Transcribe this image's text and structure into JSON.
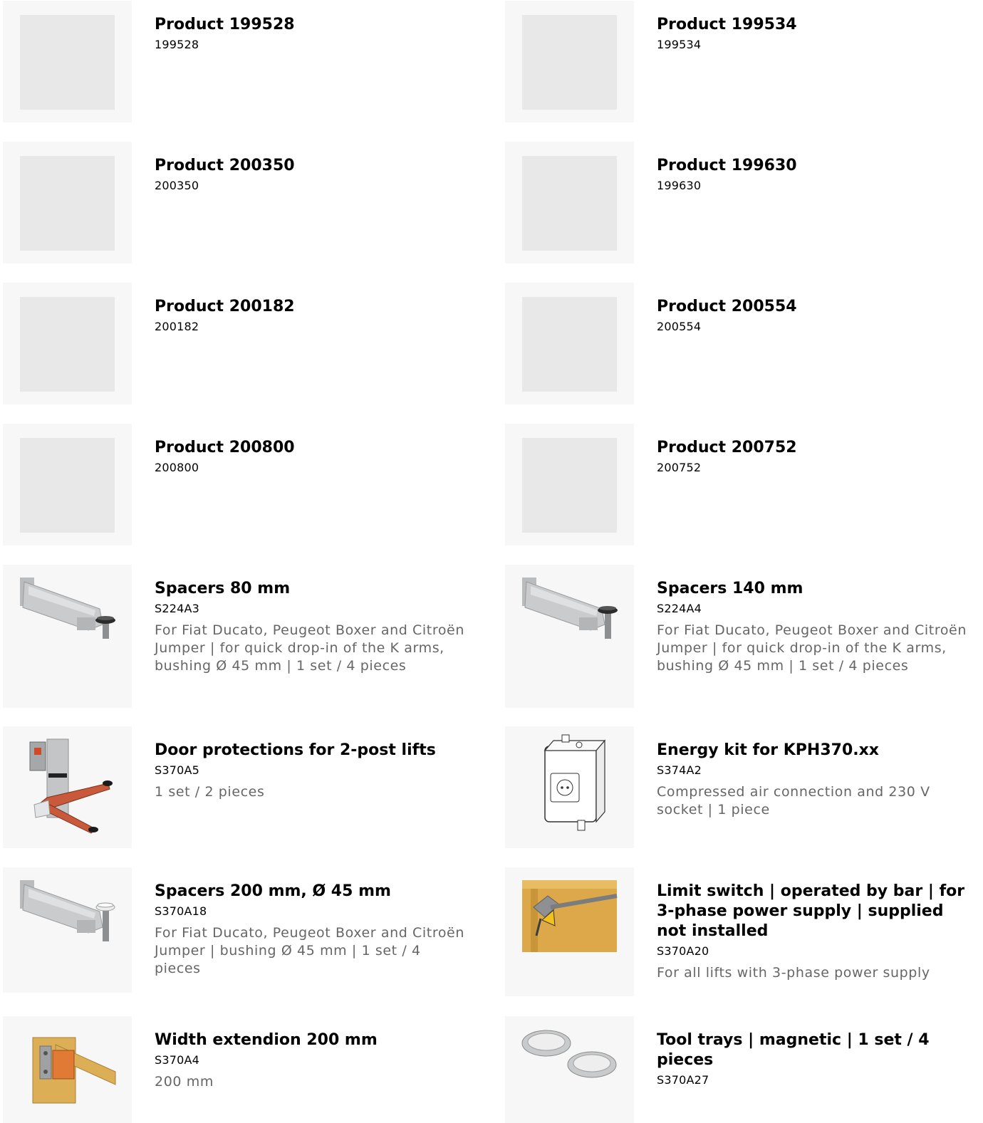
{
  "products": [
    {
      "title": "Product 199528",
      "sku": "199528",
      "desc": "",
      "image": "placeholder"
    },
    {
      "title": "Product 199534",
      "sku": "199534",
      "desc": "",
      "image": "placeholder"
    },
    {
      "title": "Product 200350",
      "sku": "200350",
      "desc": "",
      "image": "placeholder"
    },
    {
      "title": "Product 199630",
      "sku": "199630",
      "desc": "",
      "image": "placeholder"
    },
    {
      "title": "Product 200182",
      "sku": "200182",
      "desc": "",
      "image": "placeholder"
    },
    {
      "title": "Product 200554",
      "sku": "200554",
      "desc": "",
      "image": "placeholder"
    },
    {
      "title": "Product 200800",
      "sku": "200800",
      "desc": "",
      "image": "placeholder"
    },
    {
      "title": "Product 200752",
      "sku": "200752",
      "desc": "",
      "image": "placeholder"
    },
    {
      "title": "Spacers 80 mm",
      "sku": "S224A3",
      "desc": "For Fiat Ducato, Peugeot Boxer and Citroën Jumper | for quick drop-in of the K arms, bushing Ø 45 mm | 1 set / 4 pieces",
      "image": "lift-arm-dark-pad"
    },
    {
      "title": "Spacers 140 mm",
      "sku": "S224A4",
      "desc": "For Fiat Ducato, Peugeot Boxer and Citroën Jumper | for quick drop-in of the K arms, bushing Ø 45 mm | 1 set / 4 pieces",
      "image": "lift-arm-dark-pad"
    },
    {
      "title": "Door protections for 2-post lifts",
      "sku": "S370A5",
      "desc": "1 set / 2 pieces",
      "image": "lift-post-orange-arms"
    },
    {
      "title": "Energy kit for KPH370.xx",
      "sku": "S374A2",
      "desc": "Compressed air connection and 230 V socket | 1 piece",
      "image": "energy-box-drawing"
    },
    {
      "title": "Spacers 200 mm, Ø 45 mm",
      "sku": "S370A18",
      "desc": "For Fiat Ducato, Peugeot Boxer and Citroën Jumper | bushing Ø 45 mm | 1 set / 4 pieces",
      "image": "lift-arm-white-pad"
    },
    {
      "title": "Limit switch | operated by bar | for 3-phase power supply | supplied not installed",
      "sku": "S370A20",
      "desc": "For all lifts with 3-phase power supply",
      "image": "limit-switch-yellow"
    },
    {
      "title": "Width extendion 200 mm",
      "sku": "S370A4",
      "desc": "200 mm",
      "image": "width-extension-yellow"
    },
    {
      "title": "Tool trays | magnetic | 1 set / 4 pieces",
      "sku": "S370A27",
      "desc": "",
      "image": "tool-trays"
    }
  ]
}
